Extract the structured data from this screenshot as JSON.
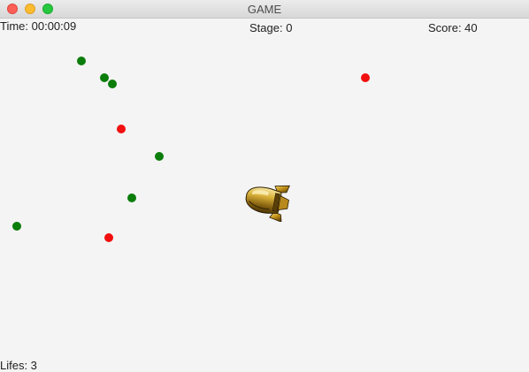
{
  "window": {
    "title": "GAME"
  },
  "hud": {
    "time": "Time: 00:00:09",
    "stage": "Stage: 0",
    "score": "Score: 40",
    "lifes": "Lifes: 3"
  },
  "colors": {
    "friendly_dot": "#0b7d0b",
    "enemy_dot": "#f10f0f",
    "ship_gold": "#c9a227",
    "background": "#f4f4f4"
  },
  "dots": [
    {
      "type": "green"
    },
    {
      "type": "green"
    },
    {
      "type": "green"
    },
    {
      "type": "red"
    },
    {
      "type": "red"
    },
    {
      "type": "green"
    },
    {
      "type": "green"
    },
    {
      "type": "green"
    },
    {
      "type": "red"
    }
  ],
  "player": {
    "icon": "spaceship-icon"
  }
}
